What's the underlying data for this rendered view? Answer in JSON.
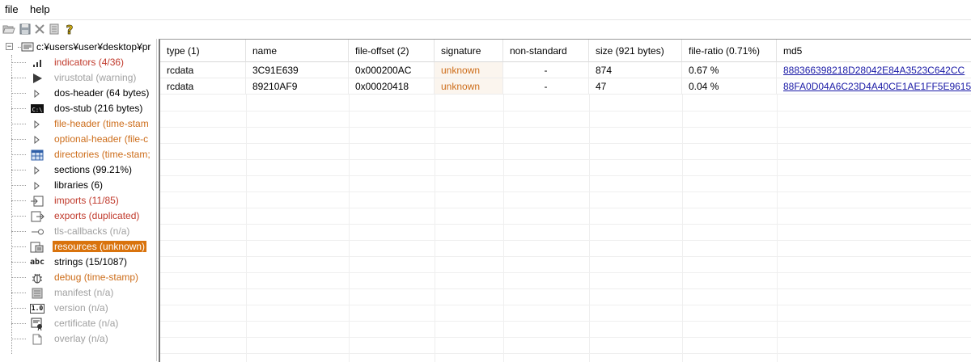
{
  "menu": {
    "file": "file",
    "help": "help"
  },
  "toolbar": {
    "buttons": [
      {
        "name": "open-icon"
      },
      {
        "name": "save-icon"
      },
      {
        "name": "close-icon"
      },
      {
        "name": "document-icon"
      },
      {
        "name": "help-icon"
      }
    ]
  },
  "tree": {
    "root": "c:¥users¥user¥desktop¥pr",
    "items": [
      {
        "label": "indicators (4/36)",
        "icon": "bar-chart-icon",
        "color": "red"
      },
      {
        "label": "virustotal (warning)",
        "icon": "flag-icon",
        "color": "gray"
      },
      {
        "label": "dos-header (64 bytes)",
        "icon": "expand-icon",
        "color": "black"
      },
      {
        "label": "dos-stub (216 bytes)",
        "icon": "console-icon",
        "color": "black"
      },
      {
        "label": "file-header (time-stam",
        "icon": "expand-icon",
        "color": "orange"
      },
      {
        "label": "optional-header (file-c",
        "icon": "expand-icon",
        "color": "orange"
      },
      {
        "label": "directories (time-stam;",
        "icon": "grid-icon",
        "color": "orange"
      },
      {
        "label": "sections (99.21%)",
        "icon": "expand-icon",
        "color": "black"
      },
      {
        "label": "libraries (6)",
        "icon": "expand-icon",
        "color": "black"
      },
      {
        "label": "imports (11/85)",
        "icon": "imports-icon",
        "color": "red"
      },
      {
        "label": "exports (duplicated)",
        "icon": "exports-icon",
        "color": "red"
      },
      {
        "label": "tls-callbacks (n/a)",
        "icon": "key-icon",
        "color": "gray"
      },
      {
        "label": "resources (unknown)",
        "icon": "resources-icon",
        "color": "selected"
      },
      {
        "label": "strings (15/1087)",
        "icon": "strings-icon",
        "color": "black",
        "icon_text": "abc"
      },
      {
        "label": "debug (time-stamp)",
        "icon": "bug-icon",
        "color": "orange"
      },
      {
        "label": "manifest (n/a)",
        "icon": "manifest-icon",
        "color": "gray"
      },
      {
        "label": "version (n/a)",
        "icon": "version-icon",
        "color": "gray",
        "icon_text": "1.0"
      },
      {
        "label": "certificate (n/a)",
        "icon": "certificate-icon",
        "color": "gray"
      },
      {
        "label": "overlay (n/a)",
        "icon": "overlay-icon",
        "color": "gray"
      }
    ]
  },
  "table": {
    "columns": [
      "type (1)",
      "name",
      "file-offset (2)",
      "signature",
      "non-standard",
      "size (921 bytes)",
      "file-ratio (0.71%)",
      "md5"
    ],
    "rows": [
      [
        "rcdata",
        "3C91E639",
        "0x000200AC",
        "unknown",
        "-",
        "874",
        "0.67 %",
        "888366398218D28042E84A3523C642CC"
      ],
      [
        "rcdata",
        "89210AF9",
        "0x00020418",
        "unknown",
        "-",
        "47",
        "0.04 %",
        "88FA0D04A6C23D4A40CE1AE1FF5E9615"
      ]
    ]
  },
  "colors": {
    "red": "#c0392b",
    "orange": "#cd6d1a",
    "gray": "#a0a0a0",
    "selected_bg": "#d9730d",
    "link": "#1a1aa6"
  }
}
